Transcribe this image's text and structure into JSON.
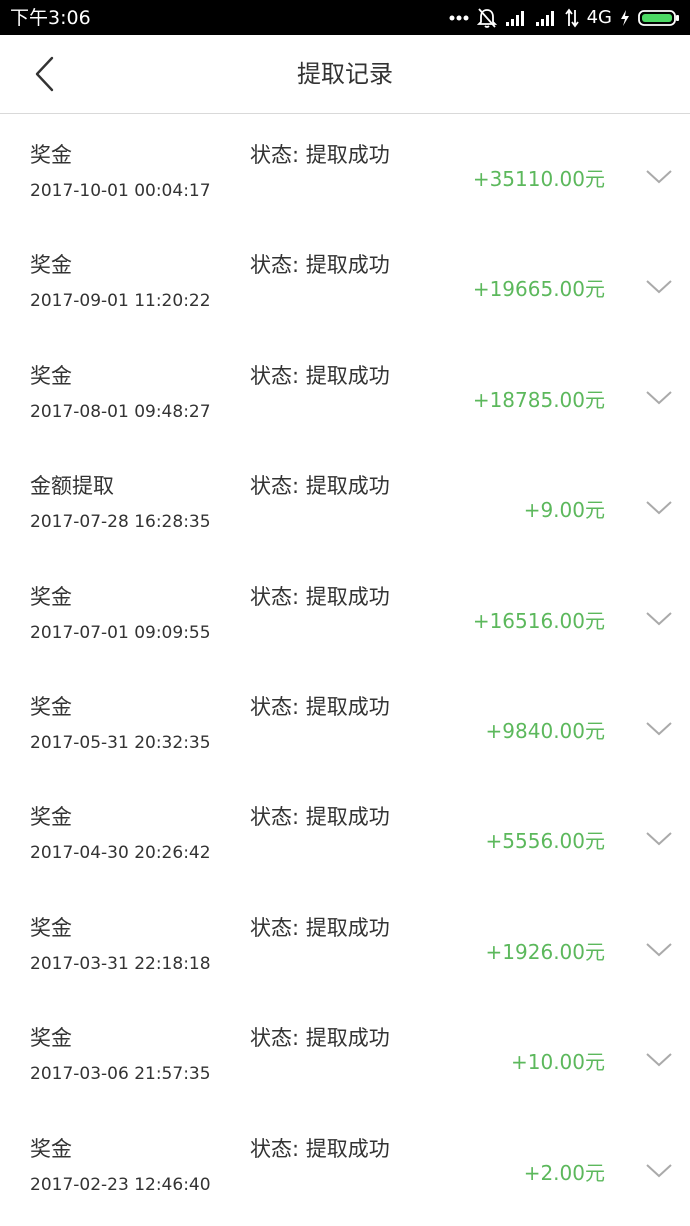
{
  "status_bar": {
    "time": "下午3:06",
    "network": "4G",
    "battery_color": "#4cd964"
  },
  "header": {
    "title": "提取记录"
  },
  "colors": {
    "amount": "#5cb85c",
    "text": "#333333"
  },
  "records": [
    {
      "type": "奖金",
      "time": "2017-10-01 00:04:17",
      "status": "状态: 提取成功",
      "amount": "+35110.00元"
    },
    {
      "type": "奖金",
      "time": "2017-09-01 11:20:22",
      "status": "状态: 提取成功",
      "amount": "+19665.00元"
    },
    {
      "type": "奖金",
      "time": "2017-08-01 09:48:27",
      "status": "状态: 提取成功",
      "amount": "+18785.00元"
    },
    {
      "type": "金额提取",
      "time": "2017-07-28 16:28:35",
      "status": "状态: 提取成功",
      "amount": "+9.00元"
    },
    {
      "type": "奖金",
      "time": "2017-07-01 09:09:55",
      "status": "状态: 提取成功",
      "amount": "+16516.00元"
    },
    {
      "type": "奖金",
      "time": "2017-05-31 20:32:35",
      "status": "状态: 提取成功",
      "amount": "+9840.00元"
    },
    {
      "type": "奖金",
      "time": "2017-04-30 20:26:42",
      "status": "状态: 提取成功",
      "amount": "+5556.00元"
    },
    {
      "type": "奖金",
      "time": "2017-03-31 22:18:18",
      "status": "状态: 提取成功",
      "amount": "+1926.00元"
    },
    {
      "type": "奖金",
      "time": "2017-03-06 21:57:35",
      "status": "状态: 提取成功",
      "amount": "+10.00元"
    },
    {
      "type": "奖金",
      "time": "2017-02-23 12:46:40",
      "status": "状态: 提取成功",
      "amount": "+2.00元"
    }
  ]
}
